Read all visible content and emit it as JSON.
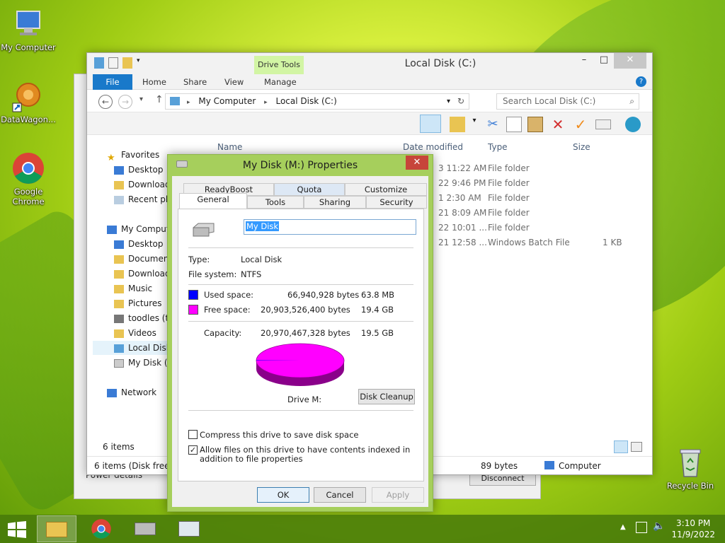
{
  "desktop": {
    "icons": [
      {
        "label": "My Computer"
      },
      {
        "label": "DataWagon..."
      },
      {
        "label": "Google Chrome"
      },
      {
        "label": "Recycle Bin"
      }
    ]
  },
  "explorer": {
    "title": "Local Disk (C:)",
    "drive_tools": "Drive Tools",
    "tabs": [
      "File",
      "Home",
      "Share",
      "View",
      "Manage"
    ],
    "address": {
      "root": "My Computer",
      "current": "Local Disk (C:)"
    },
    "search_placeholder": "Search Local Disk (C:)",
    "columns": {
      "name": "Name",
      "date": "Date modified",
      "type": "Type",
      "size": "Size"
    },
    "rows": [
      {
        "date": "3 11:22 AM",
        "type": "File folder",
        "size": ""
      },
      {
        "date": "22 9:46 PM",
        "type": "File folder",
        "size": ""
      },
      {
        "date": "1 2:30 AM",
        "type": "File folder",
        "size": ""
      },
      {
        "date": "21 8:09 AM",
        "type": "File folder",
        "size": ""
      },
      {
        "date": "22 10:01 ...",
        "type": "File folder",
        "size": ""
      },
      {
        "date": "21 12:58 ...",
        "type": "Windows Batch File",
        "size": "1 KB"
      }
    ],
    "nav": {
      "favorites": "Favorites",
      "fav_items": [
        "Desktop",
        "Downloads",
        "Recent places"
      ],
      "my_computer": "My Computer",
      "pc_items": [
        "Desktop",
        "Documents",
        "Downloads",
        "Music",
        "Pictures",
        "toodles (to",
        "Videos",
        "Local Disk",
        "My Disk (M"
      ],
      "network": "Network"
    },
    "item_count": "6 items",
    "details_left": "6 items (Disk free sp",
    "details_size": "89 bytes",
    "details_location": "Computer",
    "behind_text": "Power details",
    "behind_button": "Disconnect"
  },
  "props": {
    "title": "My Disk (M:) Properties",
    "tabs_top": [
      "ReadyBoost",
      "Quota",
      "Customize"
    ],
    "tabs_bottom": [
      "General",
      "Tools",
      "Sharing",
      "Security"
    ],
    "name_value": "My Disk",
    "type_label": "Type:",
    "type_value": "Local Disk",
    "fs_label": "File system:",
    "fs_value": "NTFS",
    "used_label": "Used space:",
    "used_bytes": "66,940,928 bytes",
    "used_human": "63.8 MB",
    "free_label": "Free space:",
    "free_bytes": "20,903,526,400 bytes",
    "free_human": "19.4 GB",
    "cap_label": "Capacity:",
    "cap_bytes": "20,970,467,328 bytes",
    "cap_human": "19.5 GB",
    "drive_label": "Drive M:",
    "cleanup": "Disk Cleanup",
    "compress": "Compress this drive to save disk space",
    "index": "Allow files on this drive to have contents indexed in addition to file properties",
    "ok": "OK",
    "cancel": "Cancel",
    "apply": "Apply",
    "used_color": "#0000ff",
    "free_color": "#ff00ff",
    "used_fraction": 0.0032
  },
  "taskbar": {
    "time": "3:10 PM",
    "date": "11/9/2022"
  }
}
